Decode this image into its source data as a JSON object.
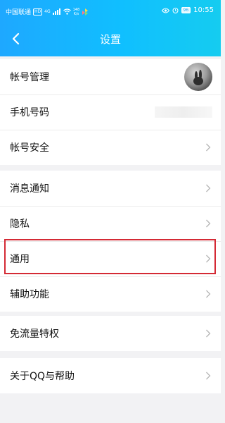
{
  "status": {
    "carrier": "中国联通",
    "hd": "HD",
    "signal": "4G",
    "speed_value": "148",
    "speed_unit": "K/s",
    "battery": "96",
    "time": "10:55"
  },
  "header": {
    "title": "设置"
  },
  "groups": [
    {
      "items": [
        {
          "label": "帐号管理"
        },
        {
          "label": "手机号码"
        },
        {
          "label": "帐号安全"
        }
      ]
    },
    {
      "items": [
        {
          "label": "消息通知"
        },
        {
          "label": "隐私"
        },
        {
          "label": "通用"
        },
        {
          "label": "辅助功能"
        }
      ]
    },
    {
      "items": [
        {
          "label": "免流量特权"
        }
      ]
    },
    {
      "items": [
        {
          "label": "关于QQ与帮助"
        }
      ]
    }
  ],
  "colors": {
    "header": "#10bfff",
    "highlight": "#d42a35",
    "background": "#f2f2f4"
  }
}
